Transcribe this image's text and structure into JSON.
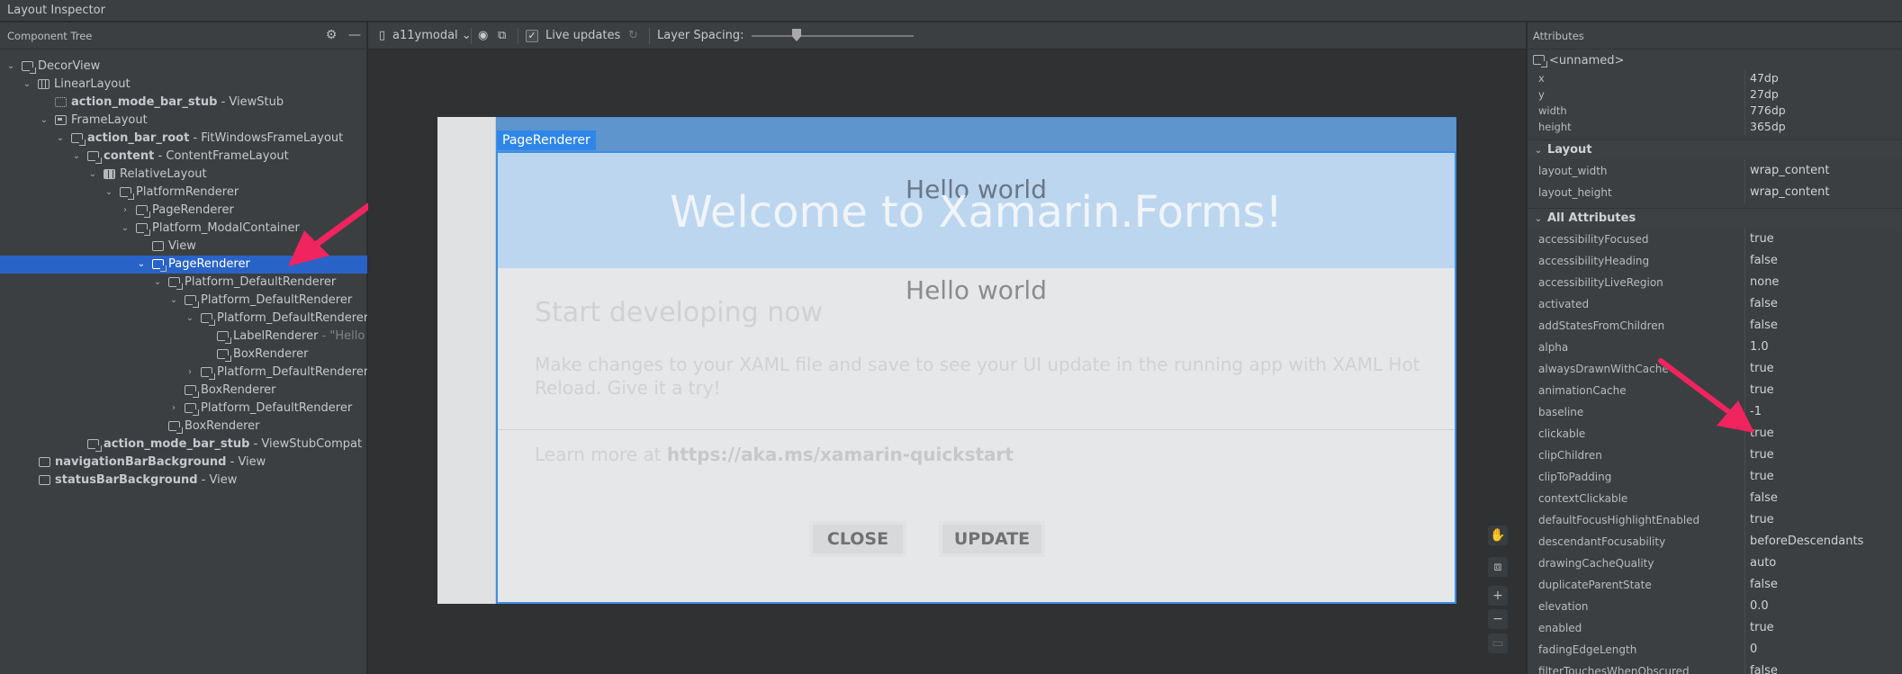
{
  "window": {
    "title": "Layout Inspector"
  },
  "component_tree": {
    "title": "Component Tree",
    "items": [
      {
        "name": "DecorView",
        "type": ""
      },
      {
        "name": "LinearLayout",
        "type": ""
      },
      {
        "name": "action_mode_bar_stub",
        "type": " - ViewStub"
      },
      {
        "name": "FrameLayout",
        "type": ""
      },
      {
        "name": "action_bar_root",
        "type": " - FitWindowsFrameLayout"
      },
      {
        "name": "content",
        "type": " - ContentFrameLayout"
      },
      {
        "name": "RelativeLayout",
        "type": ""
      },
      {
        "name": "PlatformRenderer",
        "type": ""
      },
      {
        "name": "PageRenderer",
        "type": ""
      },
      {
        "name": "Platform_ModalContainer",
        "type": ""
      },
      {
        "name": "View",
        "type": ""
      },
      {
        "name": "PageRenderer",
        "type": ""
      },
      {
        "name": "Platform_DefaultRenderer",
        "type": ""
      },
      {
        "name": "Platform_DefaultRenderer",
        "type": ""
      },
      {
        "name": "Platform_DefaultRenderer",
        "type": ""
      },
      {
        "name": "LabelRenderer",
        "type": " - \"Hello w"
      },
      {
        "name": "BoxRenderer",
        "type": ""
      },
      {
        "name": "Platform_DefaultRenderer",
        "type": ""
      },
      {
        "name": "BoxRenderer",
        "type": ""
      },
      {
        "name": "Platform_DefaultRenderer",
        "type": ""
      },
      {
        "name": "BoxRenderer",
        "type": ""
      },
      {
        "name": "action_mode_bar_stub",
        "type": " - ViewStubCompat"
      },
      {
        "name": "navigationBarBackground",
        "type": " - View"
      },
      {
        "name": "statusBarBackground",
        "type": " - View"
      }
    ]
  },
  "toolbar": {
    "device": "a11ymodal",
    "live_updates": "Live updates",
    "live_updates_checked": true,
    "layer_spacing": "Layer Spacing:"
  },
  "device_screen": {
    "page_renderer_tag": "PageRenderer",
    "hello_top": "Hello world",
    "welcome": "Welcome to Xamarin.Forms!",
    "hello_mid": "Hello world",
    "start": "Start developing now",
    "paragraph": "Make changes to your XAML file and save to see your UI update in the running app with XAML Hot Reload. Give it a try!",
    "learn_prefix": "Learn more at ",
    "learn_link": "https://aka.ms/xamarin-quickstart",
    "close_button": "CLOSE",
    "update_button": "UPDATE"
  },
  "attributes": {
    "title": "Attributes",
    "component": "<unnamed>",
    "geometry": [
      {
        "key": "x",
        "value": "47dp"
      },
      {
        "key": "y",
        "value": "27dp"
      },
      {
        "key": "width",
        "value": "776dp"
      },
      {
        "key": "height",
        "value": "365dp"
      }
    ],
    "layout_section": "Layout",
    "layout": [
      {
        "key": "layout_width",
        "value": "wrap_content"
      },
      {
        "key": "layout_height",
        "value": "wrap_content"
      }
    ],
    "all_section": "All Attributes",
    "all": [
      {
        "key": "accessibilityFocused",
        "value": "true"
      },
      {
        "key": "accessibilityHeading",
        "value": "false"
      },
      {
        "key": "accessibilityLiveRegion",
        "value": "none"
      },
      {
        "key": "activated",
        "value": "false"
      },
      {
        "key": "addStatesFromChildren",
        "value": "false"
      },
      {
        "key": "alpha",
        "value": "1.0"
      },
      {
        "key": "alwaysDrawnWithCache",
        "value": "true"
      },
      {
        "key": "animationCache",
        "value": "true"
      },
      {
        "key": "baseline",
        "value": "-1"
      },
      {
        "key": "clickable",
        "value": "true"
      },
      {
        "key": "clipChildren",
        "value": "true"
      },
      {
        "key": "clipToPadding",
        "value": "true"
      },
      {
        "key": "contextClickable",
        "value": "false"
      },
      {
        "key": "defaultFocusHighlightEnabled",
        "value": "true"
      },
      {
        "key": "descendantFocusability",
        "value": "beforeDescendants"
      },
      {
        "key": "drawingCacheQuality",
        "value": "auto"
      },
      {
        "key": "duplicateParentState",
        "value": "false"
      },
      {
        "key": "elevation",
        "value": "0.0"
      },
      {
        "key": "enabled",
        "value": "true"
      },
      {
        "key": "fadingEdgeLength",
        "value": "0"
      },
      {
        "key": "filterTouchesWhenObscured",
        "value": "false"
      }
    ]
  },
  "colors": {
    "selection": "#2a63c7",
    "accent": "#2f86e8",
    "annotation_arrow": "#f0245f"
  }
}
